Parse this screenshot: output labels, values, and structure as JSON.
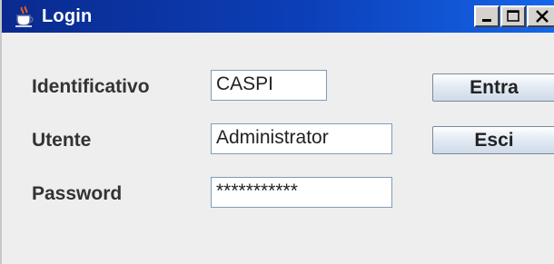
{
  "window": {
    "title": "Login",
    "app_icon": "java-cup-icon",
    "controls": {
      "minimize": "minimize-icon",
      "maximize": "maximize-icon",
      "close": "close-icon"
    }
  },
  "form": {
    "identificativo": {
      "label": "Identificativo",
      "value": "CASPI"
    },
    "utente": {
      "label": "Utente",
      "value": "Administrator"
    },
    "password": {
      "label": "Password",
      "value": "***********"
    }
  },
  "buttons": {
    "entra": "Entra",
    "esci": "Esci"
  },
  "colors": {
    "titlebar_start": "#0a2a8e",
    "titlebar_end": "#1566ea",
    "field_border": "#7f9db9"
  }
}
